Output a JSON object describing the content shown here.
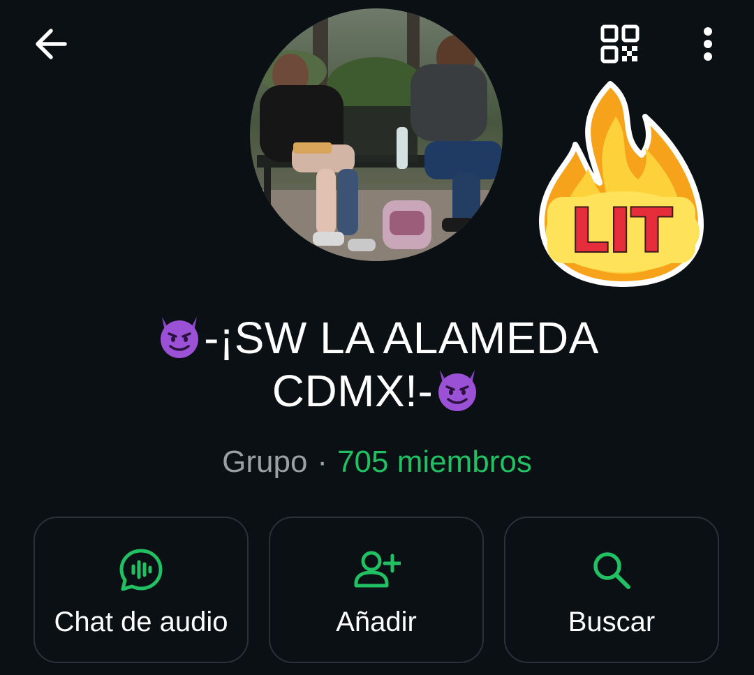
{
  "header": {
    "back_icon": "arrow-left-icon",
    "qr_icon": "qr-code-icon",
    "menu_icon": "more-vertical-icon"
  },
  "profile": {
    "avatar_description_icon": "group-photo",
    "sticker_text": "LIT",
    "name_prefix_emoji": "smiling-devil-icon",
    "name_line1": "-¡SW LA ALAMEDA",
    "name_line2": "CDMX!-",
    "name_suffix_emoji": "smiling-devil-icon",
    "type": "Grupo",
    "separator": "·",
    "members": "705 miembros"
  },
  "actions": [
    {
      "label": "Chat de audio",
      "icon": "audio-chat-icon"
    },
    {
      "label": "Añadir",
      "icon": "add-person-icon"
    },
    {
      "label": "Buscar",
      "icon": "search-icon"
    }
  ],
  "colors": {
    "background": "#0b1014",
    "accent": "#21c063",
    "muted_text": "#9aa0a4",
    "card_border": "#2a3137"
  }
}
